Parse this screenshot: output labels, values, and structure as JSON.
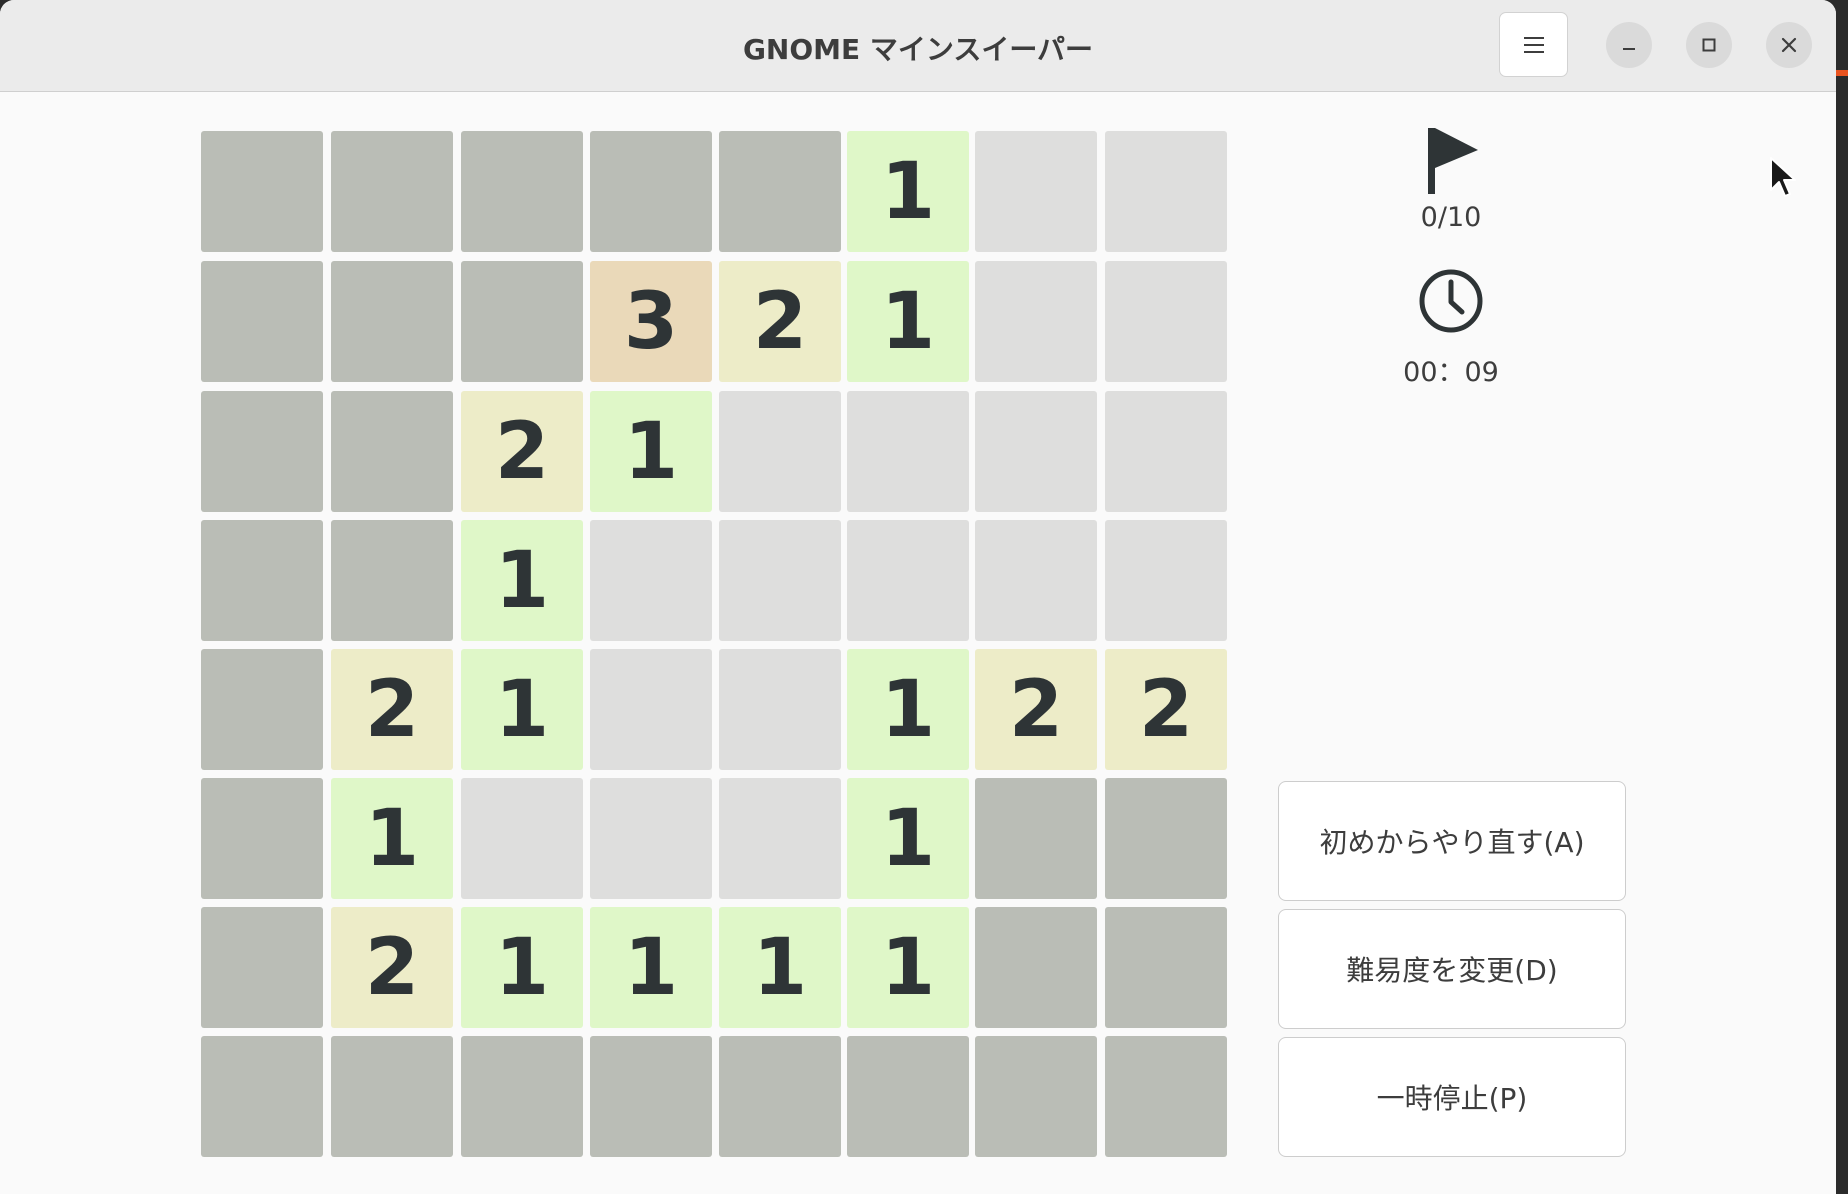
{
  "window": {
    "title": "GNOME マインスイーパー",
    "accent_color": "#e95420"
  },
  "titlebar_buttons": {
    "menu_icon": "hamburger-menu-icon",
    "minimize_icon": "minimize-icon",
    "maximize_icon": "maximize-icon",
    "close_icon": "close-icon"
  },
  "board": {
    "rows": 8,
    "cols": 8,
    "legend": "U = unrevealed, E = revealed empty, digit = adjacent mine count",
    "cells": [
      [
        "U",
        "U",
        "U",
        "U",
        "U",
        "1",
        "E",
        "E"
      ],
      [
        "U",
        "U",
        "U",
        "3",
        "2",
        "1",
        "E",
        "E"
      ],
      [
        "U",
        "U",
        "2",
        "1",
        "E",
        "E",
        "E",
        "E"
      ],
      [
        "U",
        "U",
        "1",
        "E",
        "E",
        "E",
        "E",
        "E"
      ],
      [
        "U",
        "2",
        "1",
        "E",
        "E",
        "1",
        "2",
        "2"
      ],
      [
        "U",
        "1",
        "E",
        "E",
        "E",
        "1",
        "U",
        "U"
      ],
      [
        "U",
        "2",
        "1",
        "1",
        "1",
        "1",
        "U",
        "U"
      ],
      [
        "U",
        "U",
        "U",
        "U",
        "U",
        "U",
        "U",
        "U"
      ]
    ],
    "colors": {
      "unrevealed": "#babdb6",
      "empty": "#dededd",
      "n1": "#dff7c8",
      "n2": "#edecc8",
      "n3": "#ead9b9",
      "digit": "#2e3436"
    }
  },
  "status": {
    "flag_icon": "flag-icon",
    "flags": "0/10",
    "clock_icon": "clock-icon",
    "time": "00：09"
  },
  "actions": {
    "restart": "初めからやり直す(A)",
    "change_difficulty": "難易度を変更(D)",
    "pause": "一時停止(P)"
  }
}
